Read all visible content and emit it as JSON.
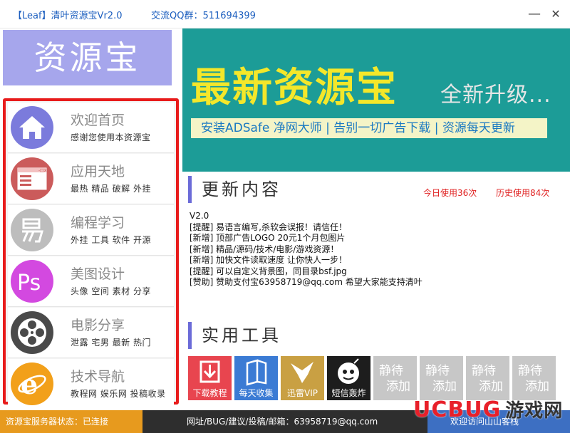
{
  "window": {
    "title": "【Leaf】清叶资源宝Vr2.0",
    "qq_group": "交流QQ群：511694399",
    "minimize_glyph": "—",
    "close_glyph": "✕"
  },
  "sidebar": {
    "logo": "资源宝",
    "items": [
      {
        "title": "欢迎首页",
        "desc": "感谢您使用本资源宝",
        "icon": "home-icon",
        "color": "#7b7bdc"
      },
      {
        "title": "应用天地",
        "desc": "最热 精品 破解 外挂",
        "icon": "window-icon",
        "color": "#cb5b5b"
      },
      {
        "title": "编程学习",
        "desc": "外挂 工具 软件 开源",
        "icon": "yi-language-icon",
        "color": "#bdbdbd"
      },
      {
        "title": "美图设计",
        "desc": "头像 空间 素材 分享",
        "icon": "photoshop-icon",
        "color": "#d349e0"
      },
      {
        "title": "电影分享",
        "desc": "泄露 宅男 最新 热门",
        "icon": "film-reel-icon",
        "color": "#4a4a4a"
      },
      {
        "title": "技术导航",
        "desc": "教程网 娱乐网 投稿收录",
        "icon": "ie-browser-icon",
        "color": "#f2a01a"
      }
    ]
  },
  "banner": {
    "headline": "最新资源宝",
    "subhead": "全新升级...",
    "strip": "安装ADSafe 净网大师 | 告别一切广告下载 | 资源每天更新"
  },
  "updates": {
    "heading": "更新内容",
    "today_usage": "今日使用36次",
    "total_usage": "历史使用84次",
    "lines": [
      "V2.0",
      "[提醒]  易语言编写,杀软会误报！请信任！",
      "[新增]  顶部广告LOGO  20元1个月包图片",
      "[新增]  精品/源码/技术/电影/游戏资源！",
      "[新增]  加快文件读取速度  让你快人一步！",
      "[提醒]  可以自定义背景图，同目录bsf.jpg",
      "[赞助]  赞助支付宝63958719@qq.com  希望大家能支持清叶"
    ]
  },
  "tools": {
    "heading": "实用工具",
    "items": [
      {
        "label": "下载教程",
        "icon": "download-icon",
        "color": "#e8454f"
      },
      {
        "label": "每天收集",
        "icon": "book-icon",
        "color": "#3b7bd4"
      },
      {
        "label": "迅雷VIP",
        "icon": "thunder-bird-icon",
        "color": "#c9a043"
      },
      {
        "label": "短信轰炸",
        "icon": "bomb-icon",
        "color": "#1d1d1d"
      },
      {
        "label": "静待添加",
        "icon": "",
        "color": "#c7c7c7"
      },
      {
        "label": "静待添加",
        "icon": "",
        "color": "#c7c7c7"
      },
      {
        "label": "静待添加",
        "icon": "",
        "color": "#c7c7c7"
      },
      {
        "label": "静待添加",
        "icon": "",
        "color": "#c7c7c7"
      }
    ]
  },
  "status": {
    "server": "资源宝服务器状态：已连接",
    "contact": "网址/BUG/建议/投稿/邮箱：63958719@qq.com",
    "visit": "欢迎访问山山客栈",
    "watermark": "UCBUG",
    "watermark2": "游戏网"
  }
}
